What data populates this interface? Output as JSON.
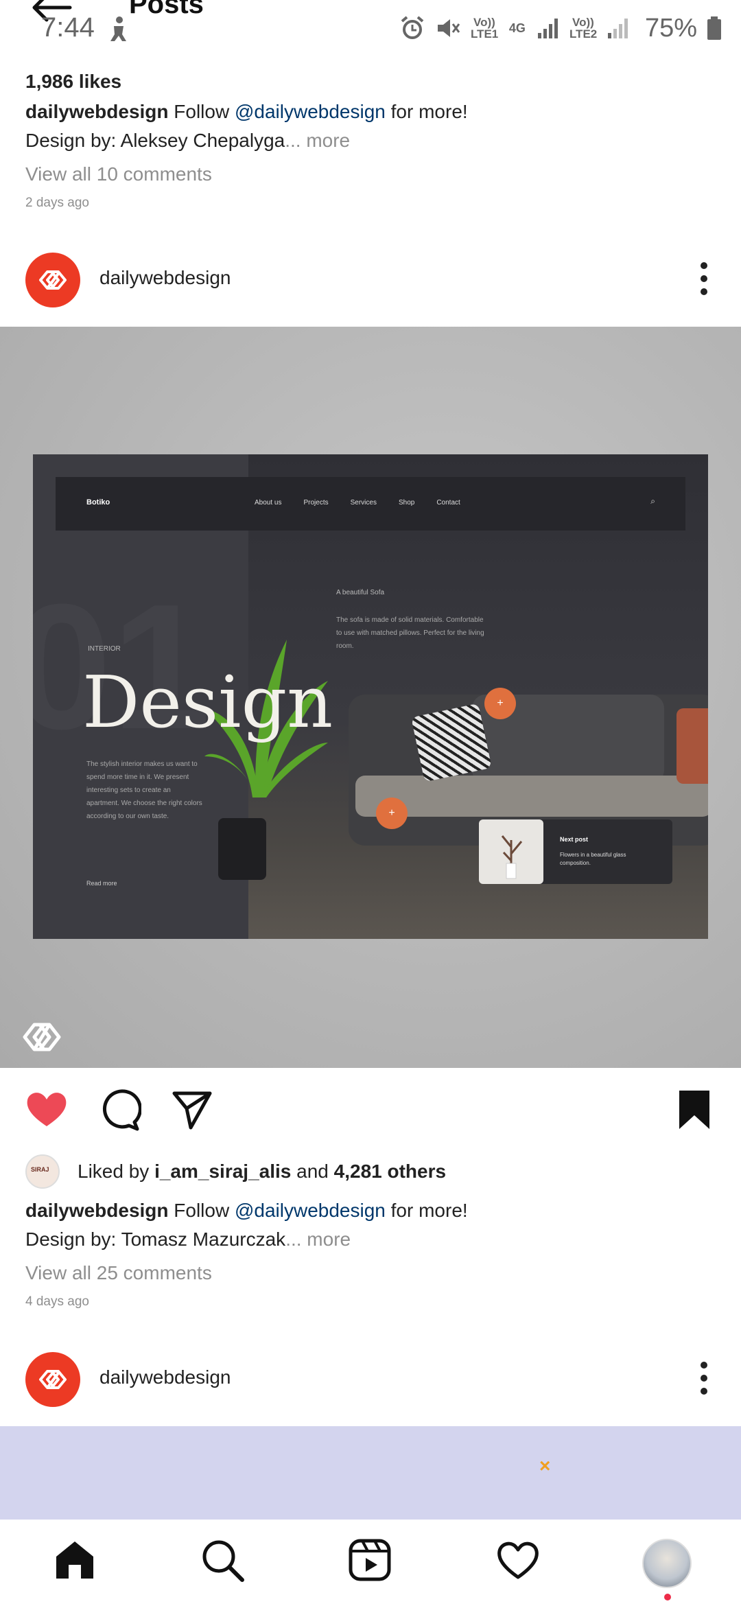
{
  "status_bar": {
    "time": "7:44",
    "sim1_label": "Vo)) LTE1",
    "net_label": "4G",
    "sim2_label": "Vo)) LTE2",
    "battery": "75%",
    "icons": [
      "alarm-icon",
      "mute-icon",
      "signal-icon",
      "battery-icon"
    ]
  },
  "header": {
    "title": "Posts"
  },
  "prev_post": {
    "likes": "1,986 likes",
    "username": "dailywebdesign",
    "caption_pre": "Follow",
    "mention": "@dailywebdesign",
    "caption_post": "for more!",
    "caption_line2": "Design by: Aleksey Chepalyga",
    "more": "... more",
    "comments": "View all 10 comments",
    "time_ago": "2 days ago"
  },
  "post": {
    "username": "dailywebdesign",
    "image": {
      "brand": "Botiko",
      "nav": [
        "About us",
        "Projects",
        "Services",
        "Shop",
        "Contact"
      ],
      "number": "01",
      "category": "INTERIOR",
      "headline": "Design",
      "left_text": "The stylish interior makes us want to spend more time in it. We present interesting sets to create an apartment. We choose the right colors according to our own taste.",
      "read_more": "Read more",
      "sofa_title": "A beautiful Sofa",
      "sofa_desc": "The sofa is made of solid materials. Comfortable to use with matched pillows. Perfect for the living room.",
      "plus": "+",
      "next_title": "Next post",
      "next_desc": "Flowers in a beautiful glass composition."
    },
    "liked_by_prefix": "Liked by",
    "liked_by_user": "i_am_siraj_alis",
    "liked_by_and": "and",
    "liked_by_others": "4,281 others",
    "caption_pre": "Follow",
    "mention": "@dailywebdesign",
    "caption_post": "for more!",
    "caption_line2": "Design by: Tomasz Mazurczak",
    "more": "... more",
    "comments": "View all 25 comments",
    "time_ago": "4 days ago",
    "liked": true,
    "saved": true
  },
  "next_post": {
    "username": "dailywebdesign"
  },
  "ad": {
    "close_glyph": "×"
  },
  "colors": {
    "like": "#ed4956",
    "brand_logo": "#ec3a24",
    "link": "#00376b",
    "ad_bg": "#d3d4ee"
  }
}
